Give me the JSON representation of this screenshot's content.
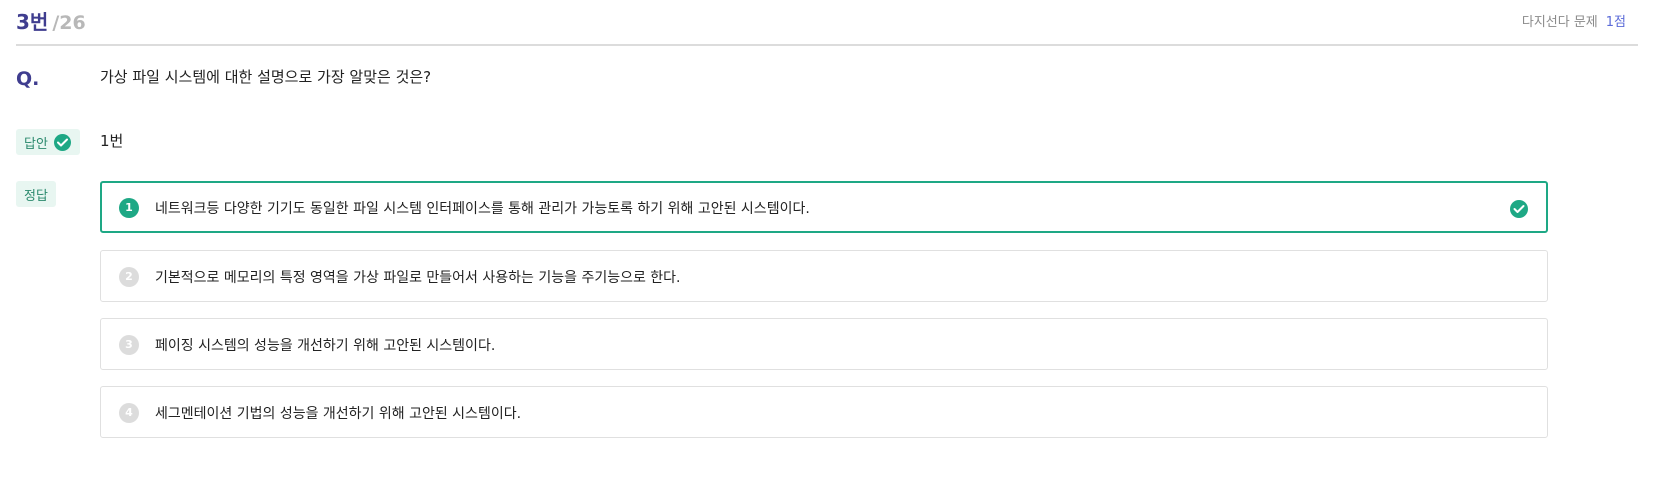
{
  "header": {
    "question_number": "3번",
    "total": "/26",
    "type_label": "다지선다 문제",
    "points": "1점"
  },
  "question": {
    "label": "Q.",
    "text": "가상 파일 시스템에 대한 설명으로 가장 알맞은 것은?"
  },
  "answer": {
    "badge_label": "답안",
    "value": "1번"
  },
  "correct": {
    "badge_label": "정답"
  },
  "options": [
    {
      "number": "1",
      "text": "네트워크등 다양한 기기도 동일한 파일 시스템 인터페이스를 통해 관리가 가능토록 하기 위해 고안된 시스템이다.",
      "correct": true
    },
    {
      "number": "2",
      "text": "기본적으로 메모리의 특정 영역을 가상 파일로 만들어서 사용하는 기능을 주기능으로 한다.",
      "correct": false
    },
    {
      "number": "3",
      "text": "페이징 시스템의 성능을 개선하기 위해 고안된 시스템이다.",
      "correct": false
    },
    {
      "number": "4",
      "text": "세그멘테이션 기법의 성능을 개선하기 위해 고안된 시스템이다.",
      "correct": false
    }
  ],
  "colors": {
    "accent": "#3f3d8f",
    "correct_green": "#1ea885",
    "badge_bg": "#e8f6f1",
    "points_blue": "#5b6bd8"
  },
  "icons": {
    "answer_check": "check-circle-icon",
    "option_check": "check-circle-icon"
  }
}
